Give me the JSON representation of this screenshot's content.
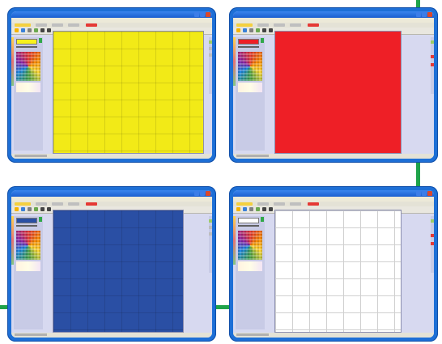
{
  "panels": [
    {
      "id": "yellow",
      "fill_color": "#f2ea17",
      "swatch_color": "#f7f11d",
      "grid": true
    },
    {
      "id": "red",
      "fill_color": "#ee1f26",
      "swatch_color": "#ee1f26",
      "grid": false
    },
    {
      "id": "blue",
      "fill_color": "#2a4fa4",
      "swatch_color": "#2a4fa4",
      "grid": true
    },
    {
      "id": "white",
      "fill_color": "#ffffff",
      "swatch_color": "#ffffff",
      "grid": true
    }
  ],
  "colors": {
    "frame_blue": "#1d6fd6",
    "connector_green": "#1fa34a",
    "app_background": "#d7d9f0"
  },
  "icons": [
    "minimize-icon",
    "maximize-icon",
    "close-icon",
    "go-icon",
    "brush-icon",
    "fill-icon",
    "eraser-icon"
  ]
}
